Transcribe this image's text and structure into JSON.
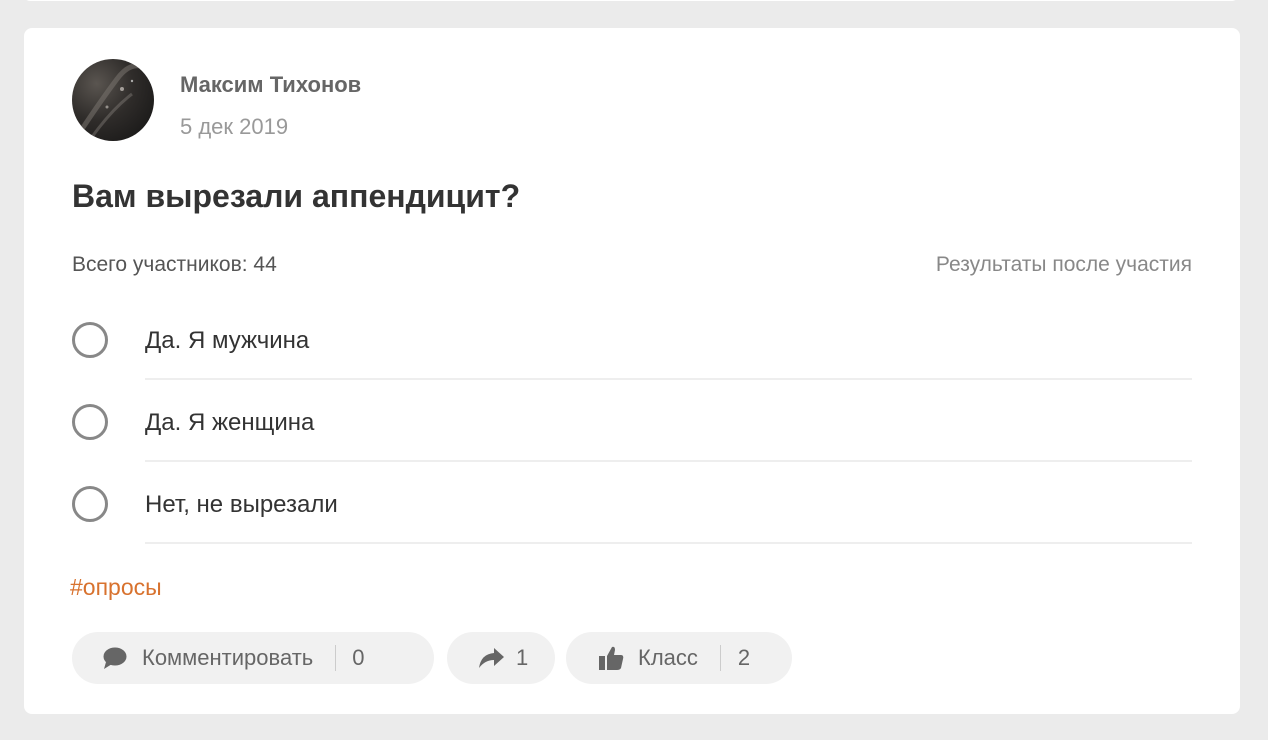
{
  "post": {
    "author": "Максим Тихонов",
    "date": "5 дек 2019",
    "question": "Вам вырезали аппендицит?",
    "participants": "Всего участников: 44",
    "results_note": "Результаты после участия",
    "options": [
      {
        "label": "Да. Я мужчина"
      },
      {
        "label": "Да. Я женщина"
      },
      {
        "label": "Нет, не вырезали"
      }
    ],
    "hashtag": "#опросы"
  },
  "actions": {
    "comment": {
      "label": "Комментировать",
      "count": "0",
      "icon": "comment-bubble-icon"
    },
    "share": {
      "count": "1",
      "icon": "share-arrow-icon"
    },
    "like": {
      "label": "Класс",
      "count": "2",
      "icon": "thumbs-up-icon"
    }
  },
  "colors": {
    "background": "#ebebeb",
    "card": "#ffffff",
    "hashtag": "#d8722e",
    "button_bg": "#f1f1f1"
  }
}
